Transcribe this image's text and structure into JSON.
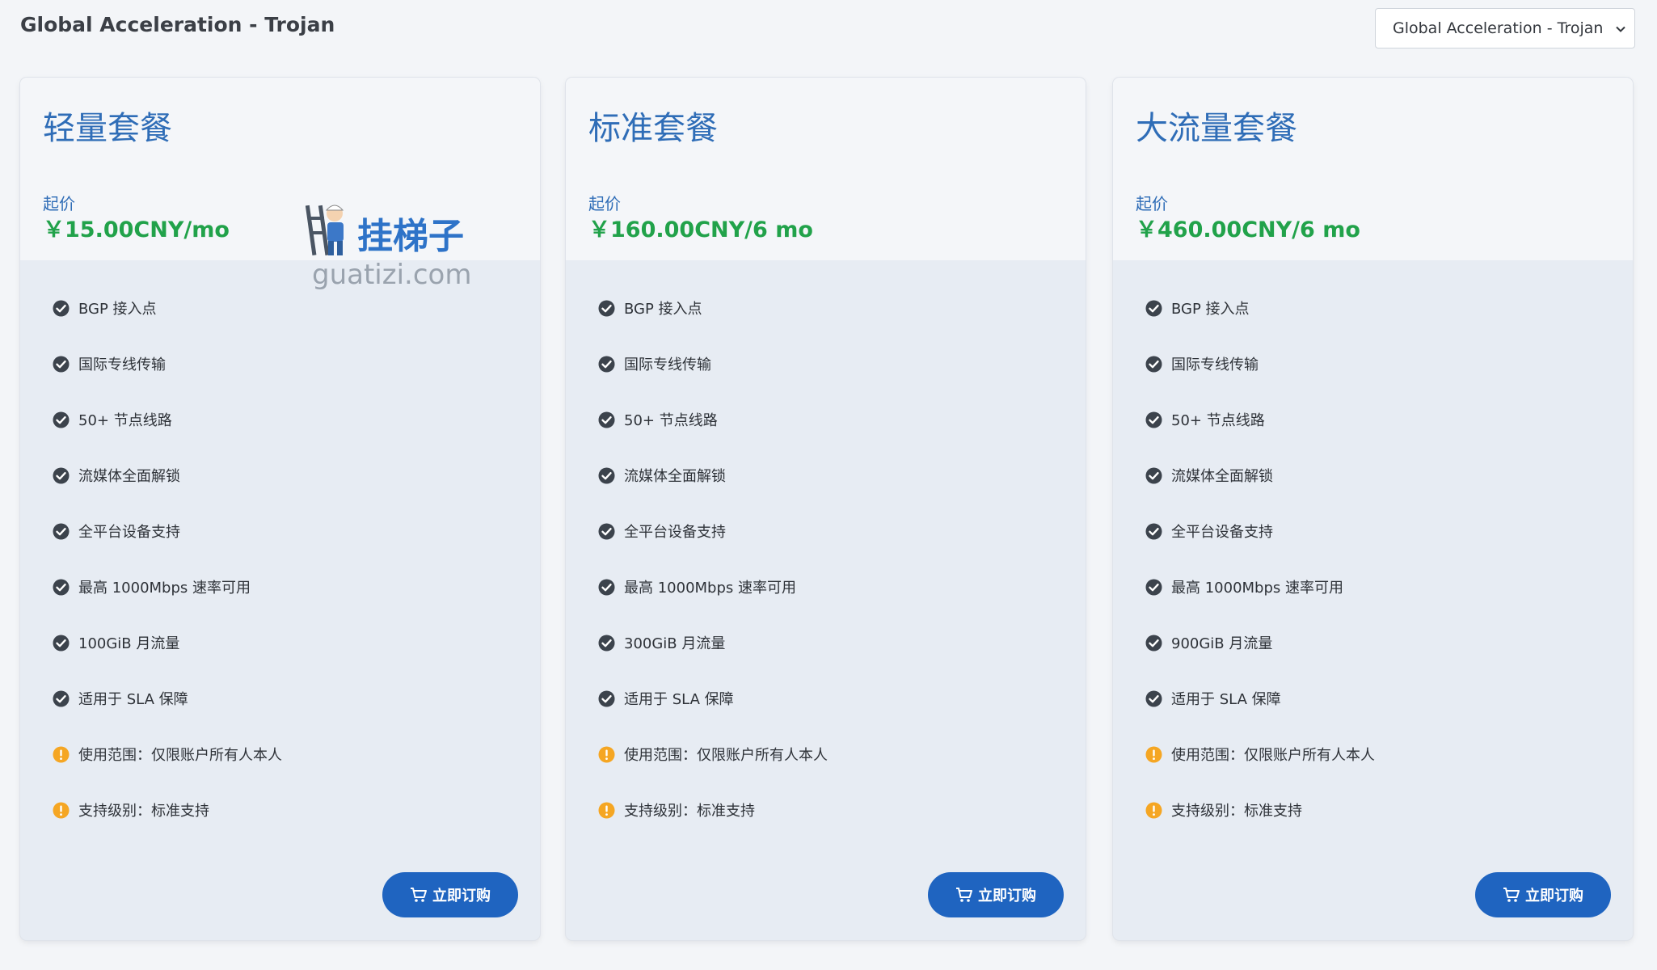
{
  "header": {
    "title": "Global Acceleration - Trojan",
    "selector_value": "Global Acceleration - Trojan"
  },
  "watermark": {
    "brand": "挂梯子",
    "domain": "guatizi.com"
  },
  "colors": {
    "plan_name": "#2f6db7",
    "price": "#21a24a",
    "button": "#1f64c0",
    "check_icon": "#3c434c",
    "warning_icon": "#f5a623"
  },
  "plans": [
    {
      "name": "轻量套餐",
      "start_label": "起价",
      "price": "￥15.00CNY/mo",
      "features": [
        {
          "icon": "check-circle-icon",
          "text": "BGP 接入点"
        },
        {
          "icon": "check-circle-icon",
          "text": "国际专线传输"
        },
        {
          "icon": "check-circle-icon",
          "text": "50+ 节点线路"
        },
        {
          "icon": "check-circle-icon",
          "text": "流媒体全面解锁"
        },
        {
          "icon": "check-circle-icon",
          "text": "全平台设备支持"
        },
        {
          "icon": "check-circle-icon",
          "text": "最高 1000Mbps 速率可用"
        },
        {
          "icon": "check-circle-icon",
          "text": "100GiB 月流量"
        },
        {
          "icon": "check-circle-icon",
          "text": "适用于 SLA 保障"
        },
        {
          "icon": "warning-circle-icon",
          "text": "使用范围：仅限账户所有人本人"
        },
        {
          "icon": "warning-circle-icon",
          "text": "支持级别：标准支持"
        }
      ],
      "button_label": "立即订购"
    },
    {
      "name": "标准套餐",
      "start_label": "起价",
      "price": "￥160.00CNY/6 mo",
      "features": [
        {
          "icon": "check-circle-icon",
          "text": "BGP 接入点"
        },
        {
          "icon": "check-circle-icon",
          "text": "国际专线传输"
        },
        {
          "icon": "check-circle-icon",
          "text": "50+ 节点线路"
        },
        {
          "icon": "check-circle-icon",
          "text": "流媒体全面解锁"
        },
        {
          "icon": "check-circle-icon",
          "text": "全平台设备支持"
        },
        {
          "icon": "check-circle-icon",
          "text": "最高 1000Mbps 速率可用"
        },
        {
          "icon": "check-circle-icon",
          "text": "300GiB 月流量"
        },
        {
          "icon": "check-circle-icon",
          "text": "适用于 SLA 保障"
        },
        {
          "icon": "warning-circle-icon",
          "text": "使用范围：仅限账户所有人本人"
        },
        {
          "icon": "warning-circle-icon",
          "text": "支持级别：标准支持"
        }
      ],
      "button_label": "立即订购"
    },
    {
      "name": "大流量套餐",
      "start_label": "起价",
      "price": "￥460.00CNY/6 mo",
      "features": [
        {
          "icon": "check-circle-icon",
          "text": "BGP 接入点"
        },
        {
          "icon": "check-circle-icon",
          "text": "国际专线传输"
        },
        {
          "icon": "check-circle-icon",
          "text": "50+ 节点线路"
        },
        {
          "icon": "check-circle-icon",
          "text": "流媒体全面解锁"
        },
        {
          "icon": "check-circle-icon",
          "text": "全平台设备支持"
        },
        {
          "icon": "check-circle-icon",
          "text": "最高 1000Mbps 速率可用"
        },
        {
          "icon": "check-circle-icon",
          "text": "900GiB 月流量"
        },
        {
          "icon": "check-circle-icon",
          "text": "适用于 SLA 保障"
        },
        {
          "icon": "warning-circle-icon",
          "text": "使用范围：仅限账户所有人本人"
        },
        {
          "icon": "warning-circle-icon",
          "text": "支持级别：标准支持"
        }
      ],
      "button_label": "立即订购"
    }
  ]
}
